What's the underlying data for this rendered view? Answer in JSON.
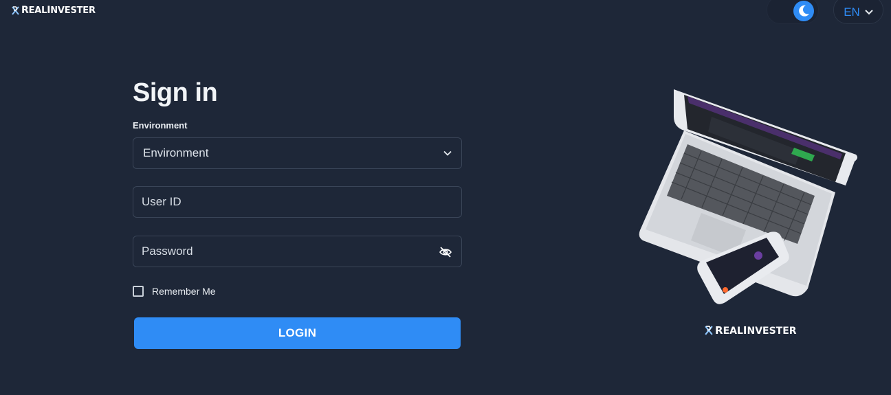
{
  "header": {
    "brand": {
      "first": "R",
      "middle": "EAL",
      "second": "I",
      "rest": "NVESTER"
    },
    "language": "EN"
  },
  "form": {
    "title": "Sign in",
    "environment_label": "Environment",
    "environment_value": "Environment",
    "user_id_placeholder": "User ID",
    "password_placeholder": "Password",
    "remember_label": "Remember Me",
    "login_label": "LOGIN"
  },
  "footer_brand": {
    "first": "R",
    "middle": "EAL",
    "second": "I",
    "rest": "NVESTER"
  },
  "colors": {
    "background": "#1e2738",
    "accent": "#2f8cf5",
    "field_border": "#3a4558"
  },
  "icons": [
    "brand-logo-icon",
    "moon-icon",
    "chevron-down-icon",
    "eye-off-icon"
  ]
}
